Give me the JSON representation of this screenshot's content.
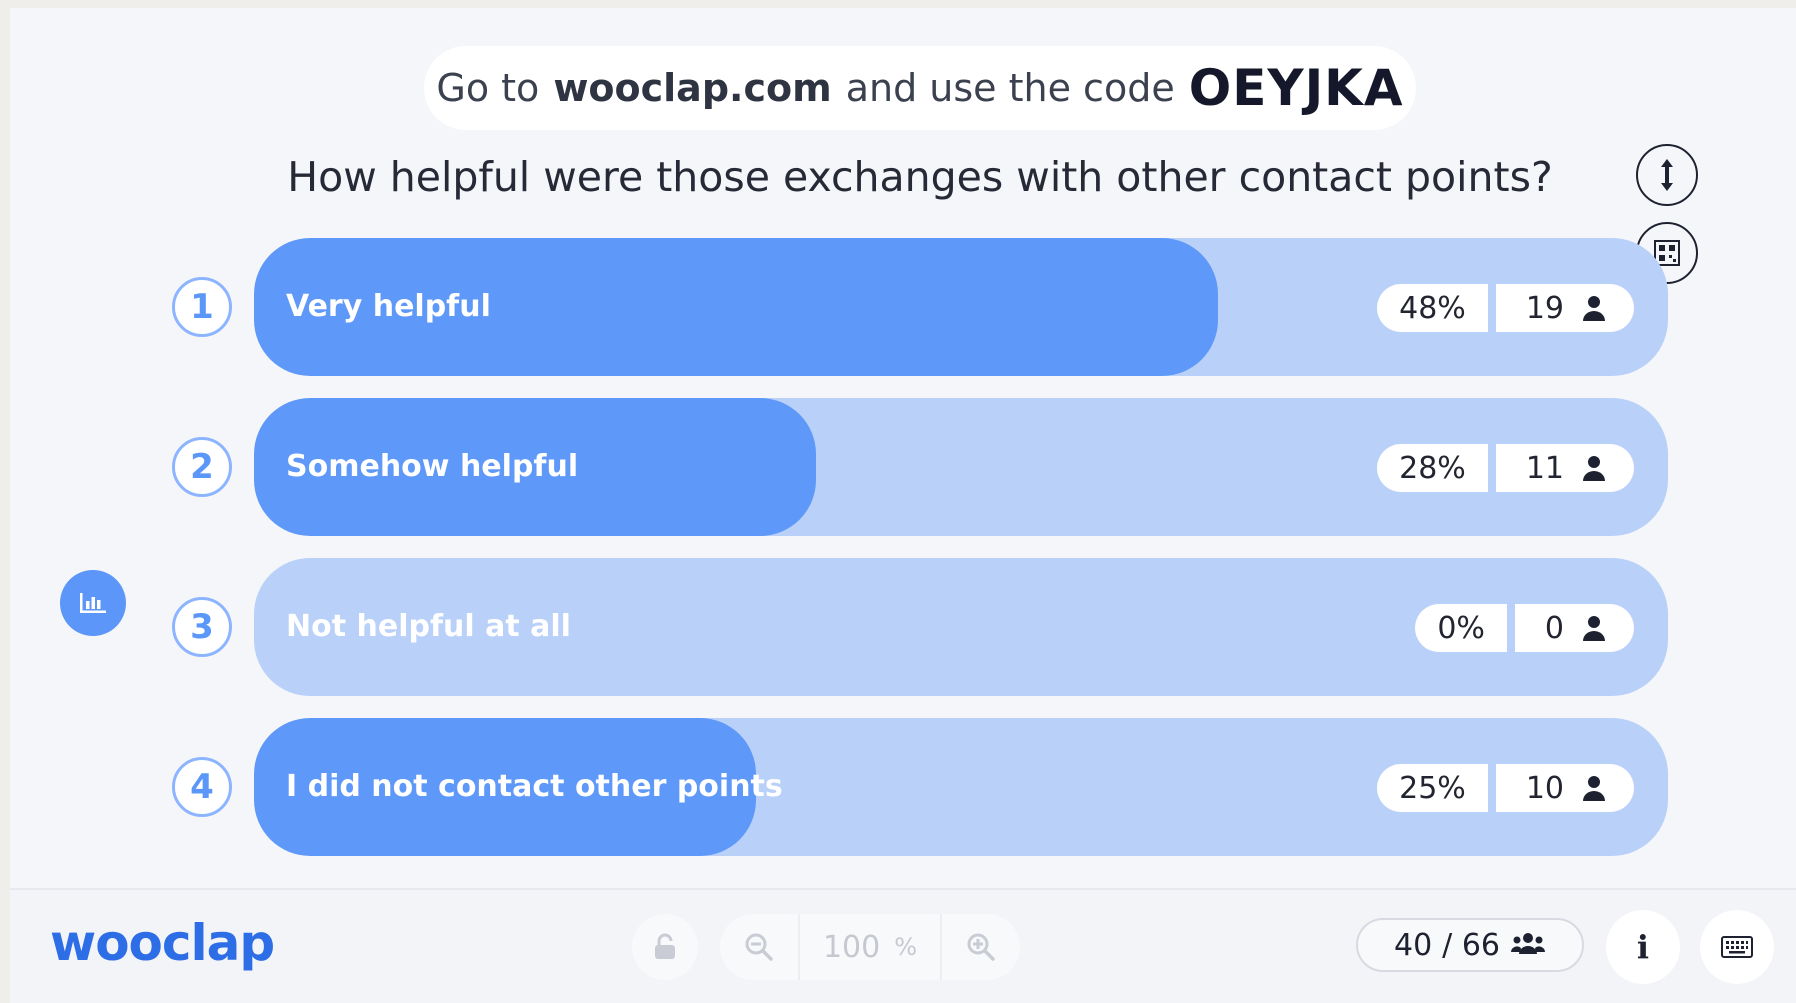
{
  "header": {
    "prefix": "Go to",
    "site": "wooclap.com",
    "middle": "and use the code",
    "code": "OEYJKA"
  },
  "question": "How helpful were those exchanges with other contact points?",
  "icons": {
    "resize": "vertical-arrows-icon",
    "qr": "qr-code-icon",
    "chart": "bar-chart-icon",
    "person": "person-icon",
    "participants": "users-icon",
    "lock": "lock-icon",
    "zoom_out": "zoom-out-icon",
    "zoom_in": "zoom-in-icon",
    "info": "info-icon",
    "keyboard": "keyboard-icon"
  },
  "colors": {
    "bar_fill": "#5e98f8",
    "bar_track": "#b9d0f9",
    "brand": "#2d6de6"
  },
  "options": [
    {
      "number": "1",
      "label": "Very helpful",
      "percent": "48%",
      "count": "19",
      "share": 0.48
    },
    {
      "number": "2",
      "label": "Somehow helpful",
      "percent": "28%",
      "count": "11",
      "share": 0.28
    },
    {
      "number": "3",
      "label": "Not helpful at all",
      "percent": "0%",
      "count": "0",
      "share": 0.0
    },
    {
      "number": "4",
      "label": "I did not contact other points",
      "percent": "25%",
      "count": "10",
      "share": 0.25
    }
  ],
  "footer": {
    "logo": "wooclap",
    "zoom_value": "100",
    "zoom_unit": "%",
    "participants_answered": "40",
    "participants_total": "/ 66",
    "info_label": "i"
  }
}
